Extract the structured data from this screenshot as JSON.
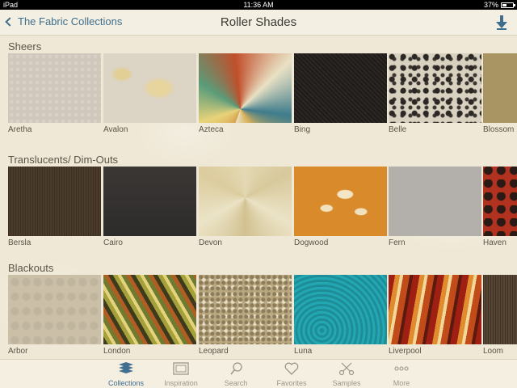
{
  "status_bar": {
    "carrier": "iPad",
    "time": "11:36 AM",
    "battery": "37%",
    "battery_level": 0.37
  },
  "nav": {
    "back_label": "The Fabric Collections",
    "title": "Roller Shades"
  },
  "sections": [
    {
      "title": "Sheers",
      "items": [
        "Aretha",
        "Avalon",
        "Azteca",
        "Bing",
        "Belle",
        "Blossom"
      ]
    },
    {
      "title": "Translucents/ Dim-Outs",
      "items": [
        "Bersla",
        "Cairo",
        "Devon",
        "Dogwood",
        "Fern",
        "Haven"
      ]
    },
    {
      "title": "Blackouts",
      "items": [
        "Arbor",
        "London",
        "Leopard",
        "Luna",
        "Liverpool",
        "Loom"
      ]
    }
  ],
  "tabs": [
    {
      "label": "Collections",
      "icon": "collections-icon",
      "active": true
    },
    {
      "label": "Inspiration",
      "icon": "inspiration-icon"
    },
    {
      "label": "Search",
      "icon": "search-icon"
    },
    {
      "label": "Favorites",
      "icon": "heart-icon"
    },
    {
      "label": "Samples",
      "icon": "scissors-icon"
    },
    {
      "label": "More",
      "icon": "more-icon"
    }
  ],
  "colors": {
    "accent": "#3f6e8e",
    "background": "#efe8d6",
    "tab_inactive": "#9c968a"
  }
}
